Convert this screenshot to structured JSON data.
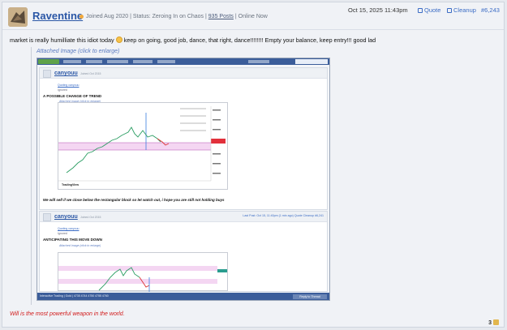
{
  "post": {
    "username": "Raventine",
    "meta_joined": "Joined Aug 2020",
    "meta_status": "Status: Zeroing In on Chaos",
    "meta_posts": "935 Posts",
    "meta_online": "Online Now",
    "date": "Oct 15, 2025 11:43pm",
    "quote_label": "Quote",
    "cleanup_label": "Cleanup",
    "post_number": "#6,243",
    "body": "market is really humilliate this idiot today",
    "body_after_emoji": "keep on going, good job, dance, that right, dance!!!!!!!! Empty your balance, keep entry!!! good lad",
    "attachment_label": "Attached Image (click to enlarge)",
    "signature": "Will is the most powerful weapon in the world.",
    "like_count": "3"
  },
  "embedded": {
    "post1": {
      "user": "canyouu",
      "joined": "Joined Oct 2015",
      "quoted": "Quoting canyouu",
      "ignored": "Ignored",
      "title": "A POSSIBLE CHANGE OF TREND",
      "attach": "Attached Image (click to enlarge)",
      "footer": "We will sell if we close below the rectangular block so let watch out, i hope you are still not holding buys",
      "tv": "TradingView"
    },
    "post2": {
      "user": "canyouu",
      "joined": "Joined Oct 2015",
      "lastpost": "Last Post: Oct 15, 11:40pm (1 min ago)   Quote   Cleanup   #6,241",
      "quoted": "Quoting canyouu",
      "ignored": "Ignored",
      "title": "ANTICIPATING THIS MOVE DOWN",
      "attach": "Attached Image (click to enlarge)"
    },
    "footer_text": "Interactive Trading  |  Gold  |  4735  4744  4750  4755  4760",
    "reply_label": "Reply to Thread"
  },
  "colors": {
    "accent": "#2b57a6",
    "nav": "#3b5d9a",
    "signature": "#d11a1a"
  }
}
